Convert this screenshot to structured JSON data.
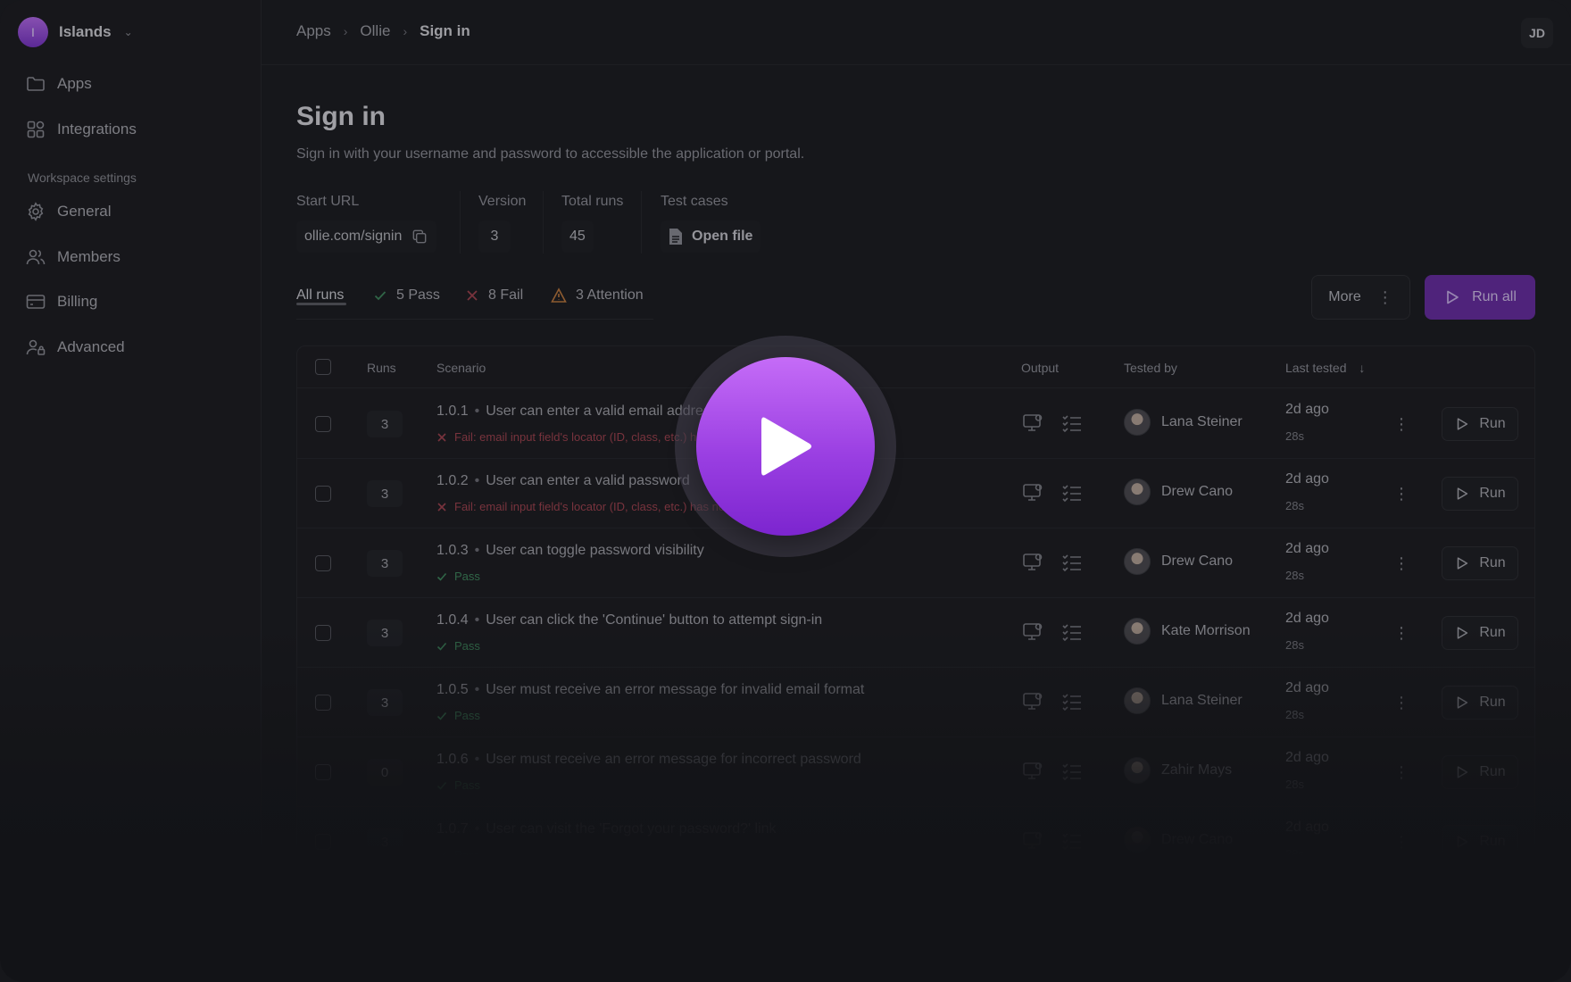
{
  "workspace": {
    "initial": "I",
    "name": "Islands"
  },
  "sidebar": {
    "items": [
      {
        "label": "Apps",
        "icon": "folder-icon"
      },
      {
        "label": "Integrations",
        "icon": "grid-icon"
      }
    ],
    "section_label": "Workspace settings",
    "settings": [
      {
        "label": "General",
        "icon": "gear-icon"
      },
      {
        "label": "Members",
        "icon": "users-icon"
      },
      {
        "label": "Billing",
        "icon": "card-icon"
      },
      {
        "label": "Advanced",
        "icon": "user-lock-icon"
      }
    ]
  },
  "breadcrumb": [
    "Apps",
    "Ollie",
    "Sign in"
  ],
  "user_initials": "JD",
  "page": {
    "title": "Sign in",
    "subtitle": "Sign in with your username and password to accessible the application or portal."
  },
  "meta": {
    "start_url_label": "Start URL",
    "start_url": "ollie.com/signin",
    "version_label": "Version",
    "version": "3",
    "total_runs_label": "Total runs",
    "total_runs": "45",
    "test_cases_label": "Test cases",
    "test_cases_link": "Open file"
  },
  "tabs": {
    "all": "All runs",
    "pass": "5 Pass",
    "fail": "8 Fail",
    "attention": "3 Attention"
  },
  "actions": {
    "more": "More",
    "run_all": "Run all"
  },
  "table": {
    "headers": {
      "runs": "Runs",
      "scenario": "Scenario",
      "output": "Output",
      "tested_by": "Tested by",
      "last_tested": "Last tested"
    },
    "rows": [
      {
        "runs": "3",
        "id": "1.0.1",
        "scenario": "User can enter a valid email address",
        "status": "Fail: email input field's locator (ID, class, etc.) has not been uniquely defined",
        "status_type": "fail",
        "tester": "Lana Steiner",
        "when": "2d ago",
        "duration": "28s",
        "run": "Run"
      },
      {
        "runs": "3",
        "id": "1.0.2",
        "scenario": "User can enter a valid password",
        "status": "Fail: email input field's locator (ID, class, etc.) has not been uniquely defined",
        "status_type": "fail",
        "tester": "Drew Cano",
        "when": "2d ago",
        "duration": "28s",
        "run": "Run"
      },
      {
        "runs": "3",
        "id": "1.0.3",
        "scenario": "User can toggle password visibility",
        "status": "Pass",
        "status_type": "pass",
        "tester": "Drew Cano",
        "when": "2d ago",
        "duration": "28s",
        "run": "Run"
      },
      {
        "runs": "3",
        "id": "1.0.4",
        "scenario": "User can click the 'Continue' button to attempt sign-in",
        "status": "Pass",
        "status_type": "pass",
        "tester": "Kate Morrison",
        "when": "2d ago",
        "duration": "28s",
        "run": "Run"
      },
      {
        "runs": "3",
        "id": "1.0.5",
        "scenario": "User must receive an error message for invalid email format",
        "status": "Pass",
        "status_type": "pass",
        "tester": "Lana Steiner",
        "when": "2d ago",
        "duration": "28s",
        "run": "Run"
      },
      {
        "runs": "0",
        "id": "1.0.6",
        "scenario": "User must receive an error message for incorrect password",
        "status": "Pass",
        "status_type": "pass",
        "tester": "Zahir Mays",
        "when": "2d ago",
        "duration": "28s",
        "run": "Run"
      },
      {
        "runs": "3",
        "id": "1.0.7",
        "scenario": "User can visit the 'Forgot your password?' link",
        "status": "Pass",
        "status_type": "pass",
        "tester": "Drew Cano",
        "when": "2d ago",
        "duration": "28s",
        "run": "Run"
      }
    ]
  },
  "colors": {
    "accent": "#7c25cf",
    "fail": "#a3434f",
    "pass": "#3f8a5e",
    "background": "#16171b"
  },
  "overlay": {
    "icon": "play-icon"
  }
}
